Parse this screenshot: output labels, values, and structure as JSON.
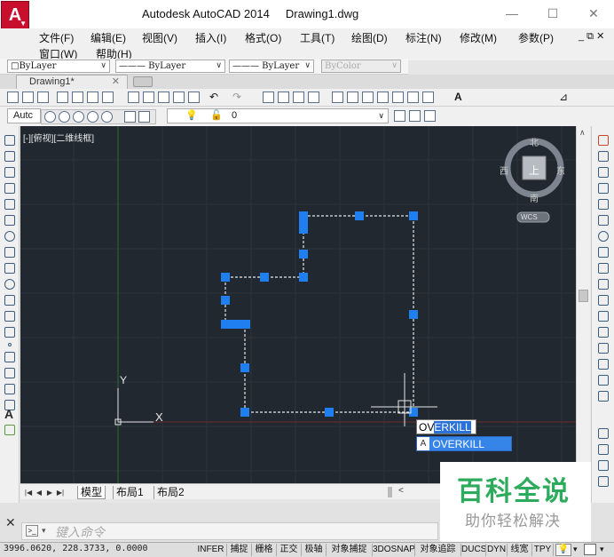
{
  "window": {
    "app_icon_label": "A",
    "title": "Autodesk AutoCAD 2014     Drawing1.dwg",
    "controls": {
      "minimize": "—",
      "maximize": "☐",
      "close": "✕"
    }
  },
  "menu": {
    "items": [
      "文件(F)",
      "编辑(E)",
      "视图(V)",
      "插入(I)",
      "格式(O)",
      "工具(T)",
      "绘图(D)",
      "标注(N)",
      "修改(M)",
      "参数(P)",
      "窗口(W)",
      "帮助(H)"
    ],
    "doc_controls": "_ ⧉ ✕"
  },
  "properties": {
    "color": "□ByLayer",
    "linetype": "——— ByLayer",
    "lineweight": "——— ByLayer",
    "plotstyle": "ByColor"
  },
  "document_tab": "Drawing1*",
  "workspace": "Autc",
  "layer": "0",
  "viewport": {
    "label": "[-][俯视][二维线框]",
    "viewcube": {
      "north": "北",
      "south": "南",
      "east": "东",
      "west": "西",
      "top": "上",
      "wcs": "WCS"
    },
    "ucs": {
      "x": "X",
      "y": "Y"
    }
  },
  "autocomplete": {
    "typed": "OV",
    "completion": "ERKILL",
    "suggestion": "OVERKILL"
  },
  "layout_tabs": [
    "模型",
    "布局1",
    "布局2"
  ],
  "command_line": {
    "placeholder": "键入命令"
  },
  "status": {
    "coords": "3996.0620, 228.3733, 0.0000",
    "buttons": [
      "INFER",
      "捕捉",
      "栅格",
      "正交",
      "极轴",
      "对象捕捉",
      "3DOSNAP",
      "对象追踪",
      "DUCS",
      "DYN",
      "线宽",
      "TPY"
    ]
  },
  "watermark": {
    "title": "百科全说",
    "subtitle": "助你轻松解决"
  },
  "colors": {
    "canvas": "#212830",
    "grip": "#1f7ff0",
    "accent_red": "#c8102e",
    "watermark_green": "#2dab5c"
  }
}
